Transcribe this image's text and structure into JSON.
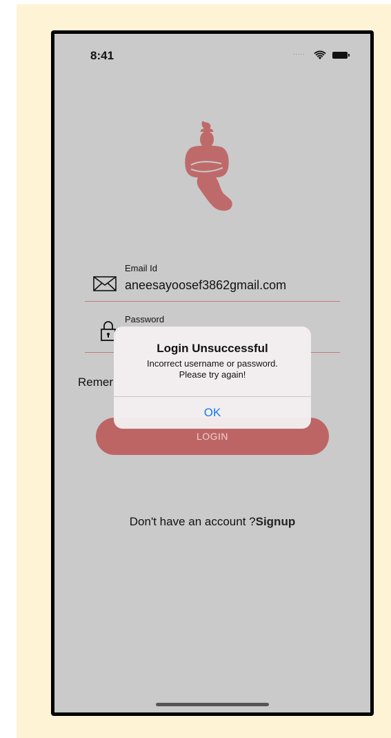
{
  "status_bar": {
    "time": "8:41",
    "signal_dots": "....."
  },
  "form": {
    "email": {
      "label": "Email Id",
      "value": "aneesayoosef3862gmail.com"
    },
    "password": {
      "label": "Password",
      "value": ""
    },
    "remember_label": "Remer",
    "login_label": "LOGIN"
  },
  "footer": {
    "prompt": "Don't have an account ?",
    "signup_label": "Signup"
  },
  "alert": {
    "title": "Login Unsuccessful",
    "message_line1": "Incorrect username or password.",
    "message_line2": "Please try again!",
    "ok_label": "OK"
  },
  "colors": {
    "accent": "#bd6565",
    "link_blue": "#1476f2",
    "screen_bg": "#cacaca",
    "backdrop": "#fff3d6"
  },
  "icons": [
    "wifi-icon",
    "battery-icon",
    "genie-logo",
    "envelope-icon",
    "lock-icon"
  ]
}
